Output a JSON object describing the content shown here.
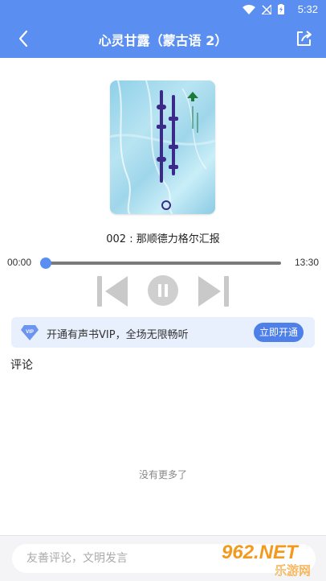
{
  "status": {
    "time": "5:32"
  },
  "header": {
    "title": "心灵甘露（蒙古语 2）"
  },
  "player": {
    "track_title": "002 : 那顺德力格尔汇报",
    "elapsed": "00:00",
    "duration": "13:30",
    "progress": 0.0
  },
  "vip": {
    "badge": "VIP",
    "promo_text": "开通有声书VIP，全场无限畅听",
    "cta_label": "立即开通"
  },
  "comments": {
    "section_label": "评论",
    "empty_text": "没有更多了",
    "input_placeholder": "友善评论，文明发言"
  },
  "watermark": {
    "brand": "962.NET",
    "site": "乐游网"
  },
  "colors": {
    "primary": "#5a8ef0",
    "cta": "#4f7fe8",
    "vip_bg": "#e8f0fe"
  }
}
